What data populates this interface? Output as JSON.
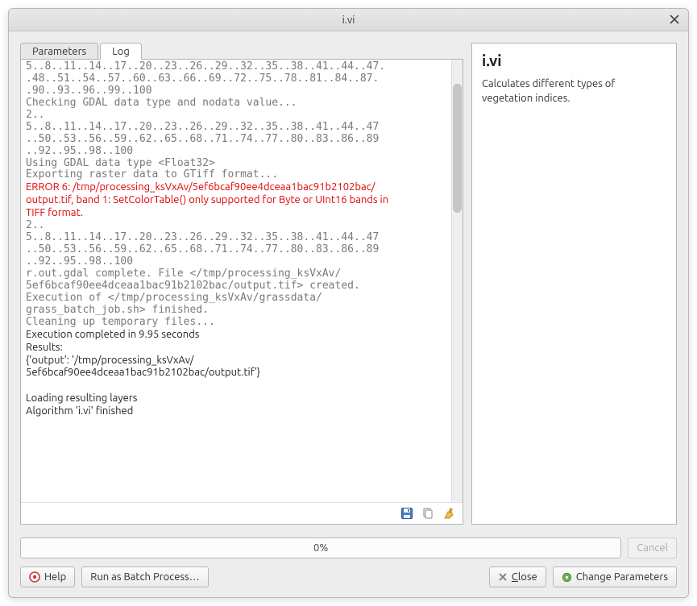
{
  "window": {
    "title": "i.vi"
  },
  "tabs": {
    "parameters": "Parameters",
    "log": "Log"
  },
  "sidebar": {
    "heading": "i.vi",
    "description": "Calculates different types of vegetation indices."
  },
  "progress": {
    "text": "0%"
  },
  "buttons": {
    "cancel": "Cancel",
    "help": "Help",
    "batch": "Run as Batch Process…",
    "close": "Close",
    "change": "Change Parameters"
  },
  "icons": {
    "close_window": "close-icon",
    "save": "save-icon",
    "copy": "copy-icon",
    "clear": "clear-icon",
    "help": "help-icon",
    "cancel_small": "cancel-icon",
    "gear": "gear-icon"
  },
  "log": {
    "l01": "5..8..11..14..17..20..23..26..29..32..35..38..41..44..47.",
    "l02": ".48..51..54..57..60..63..66..69..72..75..78..81..84..87.",
    "l03": ".90..93..96..99..100",
    "l04": "Checking GDAL data type and nodata value...",
    "l05": "2..",
    "l06": "5..8..11..14..17..20..23..26..29..32..35..38..41..44..47",
    "l07": "..50..53..56..59..62..65..68..71..74..77..80..83..86..89",
    "l08": "..92..95..98..100",
    "l09": "Using GDAL data type <Float32>",
    "l10": "Exporting raster data to GTiff format...",
    "err1": "ERROR 6: /tmp/processing_ksVxAv/5ef6bcaf90ee4dceaa1bac91b2102bac/",
    "err2": "output.tif, band 1: SetColorTable() only supported for Byte or UInt16 bands in ",
    "err3": "TIFF format.",
    "l11": "2..",
    "l12": "5..8..11..14..17..20..23..26..29..32..35..38..41..44..47",
    "l13": "..50..53..56..59..62..65..68..71..74..77..80..83..86..89",
    "l14": "..92..95..98..100",
    "l15": "r.out.gdal complete. File </tmp/processing_ksVxAv/",
    "l16": "5ef6bcaf90ee4dceaa1bac91b2102bac/output.tif> created.",
    "l17": "Execution of </tmp/processing_ksVxAv/grassdata/",
    "l18": "grass_batch_job.sh> finished.",
    "l19": "Cleaning up temporary files...",
    "n1": "Execution completed in 9.95 seconds",
    "n2": "Results:",
    "n3": "{'output': '/tmp/processing_ksVxAv/",
    "n4": "5ef6bcaf90ee4dceaa1bac91b2102bac/output.tif'}",
    "n5": "",
    "n6": "Loading resulting layers",
    "n7": "Algorithm 'i.vi' finished"
  }
}
